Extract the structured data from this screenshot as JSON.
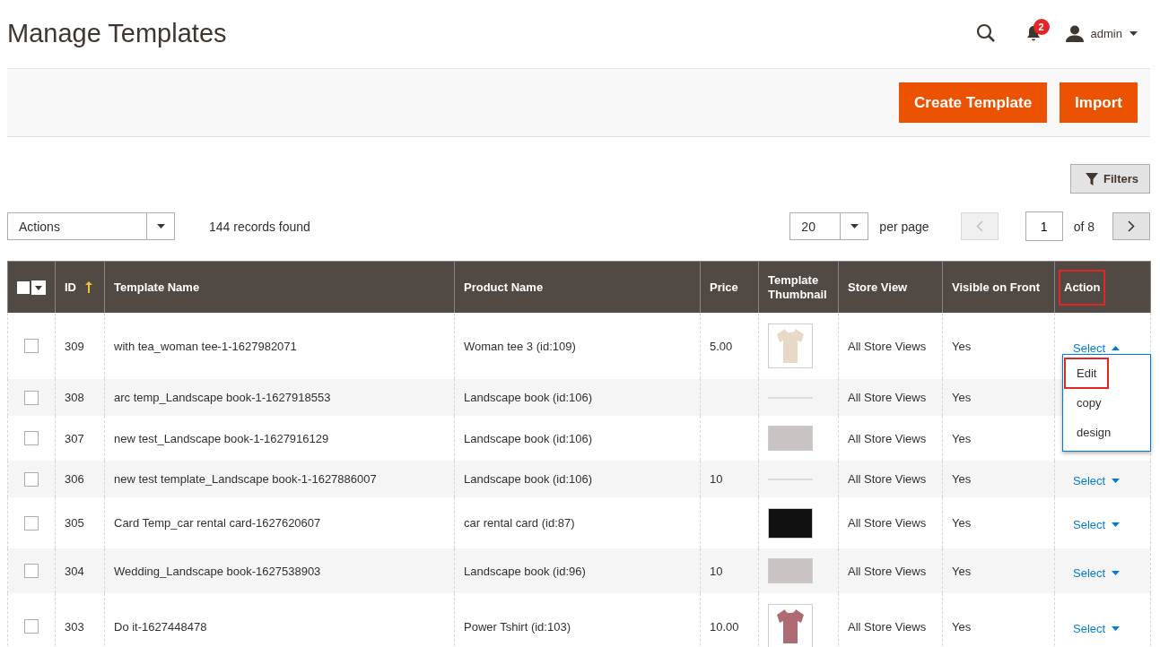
{
  "page_title": "Manage Templates",
  "header": {
    "notification_count": "2",
    "user": "admin"
  },
  "page_actions": [
    {
      "label": "Create Template"
    },
    {
      "label": "Import"
    }
  ],
  "filters_button": "Filters",
  "mass_actions": {
    "value": "Actions"
  },
  "records_found": "144 records found",
  "pager": {
    "per_page": "20",
    "per_page_label": "per page",
    "page": "1",
    "of_pages": "of 8",
    "prev_disabled": true,
    "next_disabled": false
  },
  "columns": [
    {
      "label": "ID",
      "sorted": true,
      "highlighted": false
    },
    {
      "label": "Template Name",
      "sorted": false,
      "highlighted": false
    },
    {
      "label": "Product Name",
      "sorted": false,
      "highlighted": false
    },
    {
      "label": "Price",
      "sorted": false,
      "highlighted": false
    },
    {
      "label": "Template Thumbnail",
      "sorted": false,
      "highlighted": false
    },
    {
      "label": "Store View",
      "sorted": false,
      "highlighted": false
    },
    {
      "label": "Visible on Front",
      "sorted": false,
      "highlighted": false
    },
    {
      "label": "Action",
      "sorted": false,
      "highlighted": true
    }
  ],
  "rows": [
    {
      "checked": false,
      "id": "309",
      "template_name": "with tea_woman tee-1-1627982071",
      "product_name": "Woman tee 3 (id:109)",
      "price": "5.00",
      "thumbnail": {
        "kind": "portrait"
      },
      "store_view": "All Store Views",
      "visible": "Yes",
      "action": "Select",
      "expanded": true,
      "menu": [
        {
          "label": "Edit",
          "highlighted": true
        },
        {
          "label": "copy",
          "highlighted": false
        },
        {
          "label": "design",
          "highlighted": false
        }
      ]
    },
    {
      "checked": false,
      "id": "308",
      "template_name": "arc temp_Landscape book-1-1627918553",
      "product_name": "Landscape book (id:106)",
      "thumbnail": {
        "kind": "blank"
      },
      "store_view": "All Store Views",
      "visible": "Yes"
    },
    {
      "checked": false,
      "id": "307",
      "template_name": "new test_Landscape book-1-1627916129",
      "product_name": "Landscape book (id:106)",
      "thumbnail": {
        "kind": "landscape"
      },
      "store_view": "All Store Views",
      "visible": "Yes"
    },
    {
      "checked": false,
      "id": "306",
      "template_name": "new test template_Landscape book-1-1627886007",
      "product_name": "Landscape book (id:106)",
      "price": "10",
      "thumbnail": {
        "kind": "blank"
      },
      "store_view": "All Store Views",
      "visible": "Yes",
      "action": "Select",
      "expanded": false
    },
    {
      "checked": false,
      "id": "305",
      "template_name": "Card Temp_car rental card-1627620607",
      "product_name": "car rental card (id:87)",
      "thumbnail": {
        "kind": "dark"
      },
      "store_view": "All Store Views",
      "visible": "Yes",
      "action": "Select",
      "expanded": false
    },
    {
      "checked": false,
      "id": "304",
      "template_name": "Wedding_Landscape book-1627538903",
      "product_name": "Landscape book (id:96)",
      "price": "10",
      "thumbnail": {
        "kind": "landscape"
      },
      "store_view": "All Store Views",
      "visible": "Yes",
      "action": "Select",
      "expanded": false
    },
    {
      "checked": false,
      "id": "303",
      "template_name": "Do it-1627448478",
      "product_name": "Power Tshirt (id:103)",
      "price": "10.00",
      "thumbnail": {
        "kind": "portrait"
      },
      "store_view": "All Store Views",
      "visible": "Yes",
      "action": "Select",
      "expanded": false
    }
  ]
}
